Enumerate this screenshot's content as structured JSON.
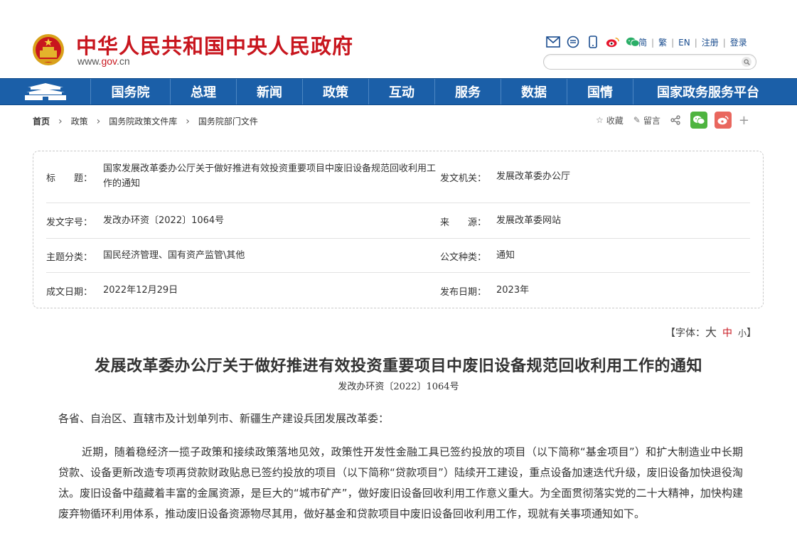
{
  "header": {
    "site_title": "中华人民共和国中央人民政府",
    "site_url_prefix": "www.",
    "site_url_gov": "gov",
    "site_url_suffix": ".cn",
    "links": [
      "简",
      "繁",
      "EN",
      "注册",
      "登录"
    ],
    "search_placeholder": ""
  },
  "nav": {
    "items": [
      "国务院",
      "总理",
      "新闻",
      "政策",
      "互动",
      "服务",
      "数据",
      "国情",
      "国家政务服务平台"
    ]
  },
  "breadcrumb": [
    "首页",
    "政策",
    "国务院政策文件库",
    "国务院部门文件"
  ],
  "actions": {
    "favorite": "收藏",
    "comment": "留言"
  },
  "info": {
    "title_label": "标　　题：",
    "title_value": "国家发展改革委办公厅关于做好推进有效投资重要项目中废旧设备规范回收利用工作的通知",
    "issuer_label": "发文机关：",
    "issuer_value": "发展改革委办公厅",
    "docno_label": "发文字号：",
    "docno_value": "发改办环资〔2022〕1064号",
    "source_label": "来　　源：",
    "source_value": "发展改革委网站",
    "category_label": "主题分类：",
    "category_value": "国民经济管理、国有资产监管\\其他",
    "type_label": "公文种类：",
    "type_value": "通知",
    "date_label": "成文日期：",
    "date_value": "2022年12月29日",
    "pubdate_label": "发布日期：",
    "pubdate_value": "2023年"
  },
  "fontsize": {
    "open": "【字体：",
    "large": "大",
    "medium": "中",
    "small": "小",
    "close": "】"
  },
  "article": {
    "title": "发展改革委办公厅关于做好推进有效投资重要项目中废旧设备规范回收利用工作的通知",
    "code": "发改办环资〔2022〕1064号",
    "greeting": "各省、自治区、直辖市及计划单列市、新疆生产建设兵团发展改革委：",
    "paragraph1": "近期，随着稳经济一揽子政策和接续政策落地见效，政策性开发性金融工具已签约投放的项目（以下简称“基金项目”）和扩大制造业中长期贷款、设备更新改造专项再贷款财政贴息已签约投放的项目（以下简称“贷款项目”）陆续开工建设，重点设备加速迭代升级，废旧设备加快退役淘汰。废旧设备中蕴藏着丰富的金属资源，是巨大的“城市矿产”，做好废旧设备回收利用工作意义重大。为全面贯彻落实党的二十大精神，加快构建废弃物循环利用体系，推动废旧设备资源物尽其用，做好基金和贷款项目中废旧设备回收利用工作，现就有关事项通知如下。"
  },
  "colors": {
    "brand_red": "#c8161e",
    "nav_blue": "#1b5fa8"
  }
}
